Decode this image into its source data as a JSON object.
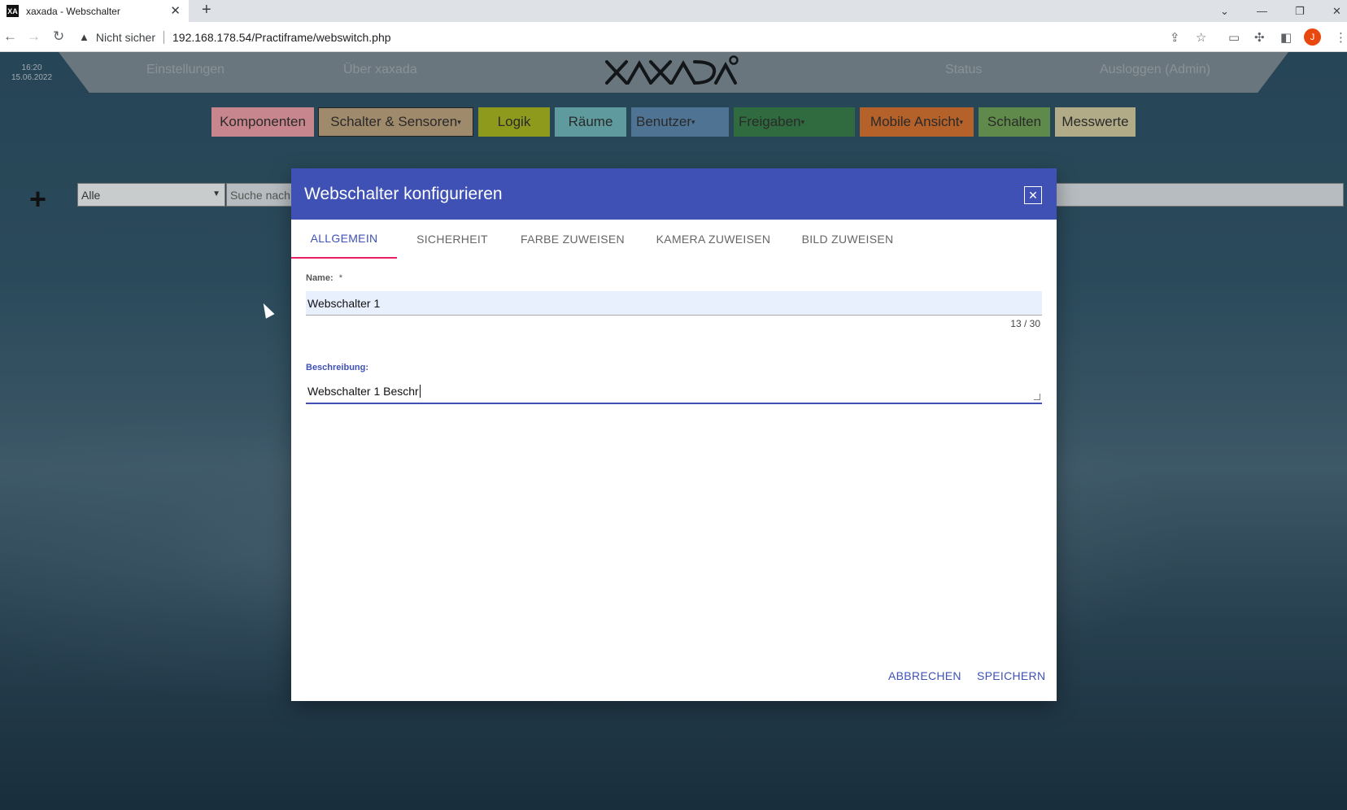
{
  "browser": {
    "tab_title": "xaxada - Webschalter",
    "favicon_text": "XA",
    "not_secure": "Nicht sicher",
    "url": "192.168.178.54/Practiframe/webswitch.php",
    "profile_initial": "J"
  },
  "page": {
    "time": "16:20",
    "date": "15.06.2022",
    "topnav": {
      "settings": "Einstellungen",
      "about": "Über xaxada",
      "status": "Status",
      "logout": "Ausloggen (Admin)"
    },
    "menu": [
      {
        "label": "Komponenten",
        "color": "#c7868d"
      },
      {
        "label": "Schalter & Sensoren",
        "color": "#a08a6c"
      },
      {
        "label": "Logik",
        "color": "#8e9a1c"
      },
      {
        "label": "Räume",
        "color": "#5e9a9e"
      },
      {
        "label": "Benutzer",
        "color": "#4f7392"
      },
      {
        "label": "Freigaben",
        "color": "#2f6b3e"
      },
      {
        "label": "Mobile Ansicht",
        "color": "#b5622a"
      },
      {
        "label": "Schalten",
        "color": "#5f8a4b"
      },
      {
        "label": "Messwerte",
        "color": "#b1ab88"
      }
    ],
    "filter_value": "Alle",
    "search_placeholder": "Suche nach"
  },
  "dialog": {
    "title": "Webschalter konfigurieren",
    "tabs": [
      "ALLGEMEIN",
      "SICHERHEIT",
      "FARBE ZUWEISEN",
      "KAMERA ZUWEISEN",
      "BILD ZUWEISEN"
    ],
    "name_label": "Name:",
    "required_mark": "*",
    "name_value": "Webschalter 1",
    "name_counter": "13 / 30",
    "description_label": "Beschreibung:",
    "description_value": "Webschalter 1 Beschr",
    "cancel": "ABBRECHEN",
    "save": "SPEICHERN"
  }
}
